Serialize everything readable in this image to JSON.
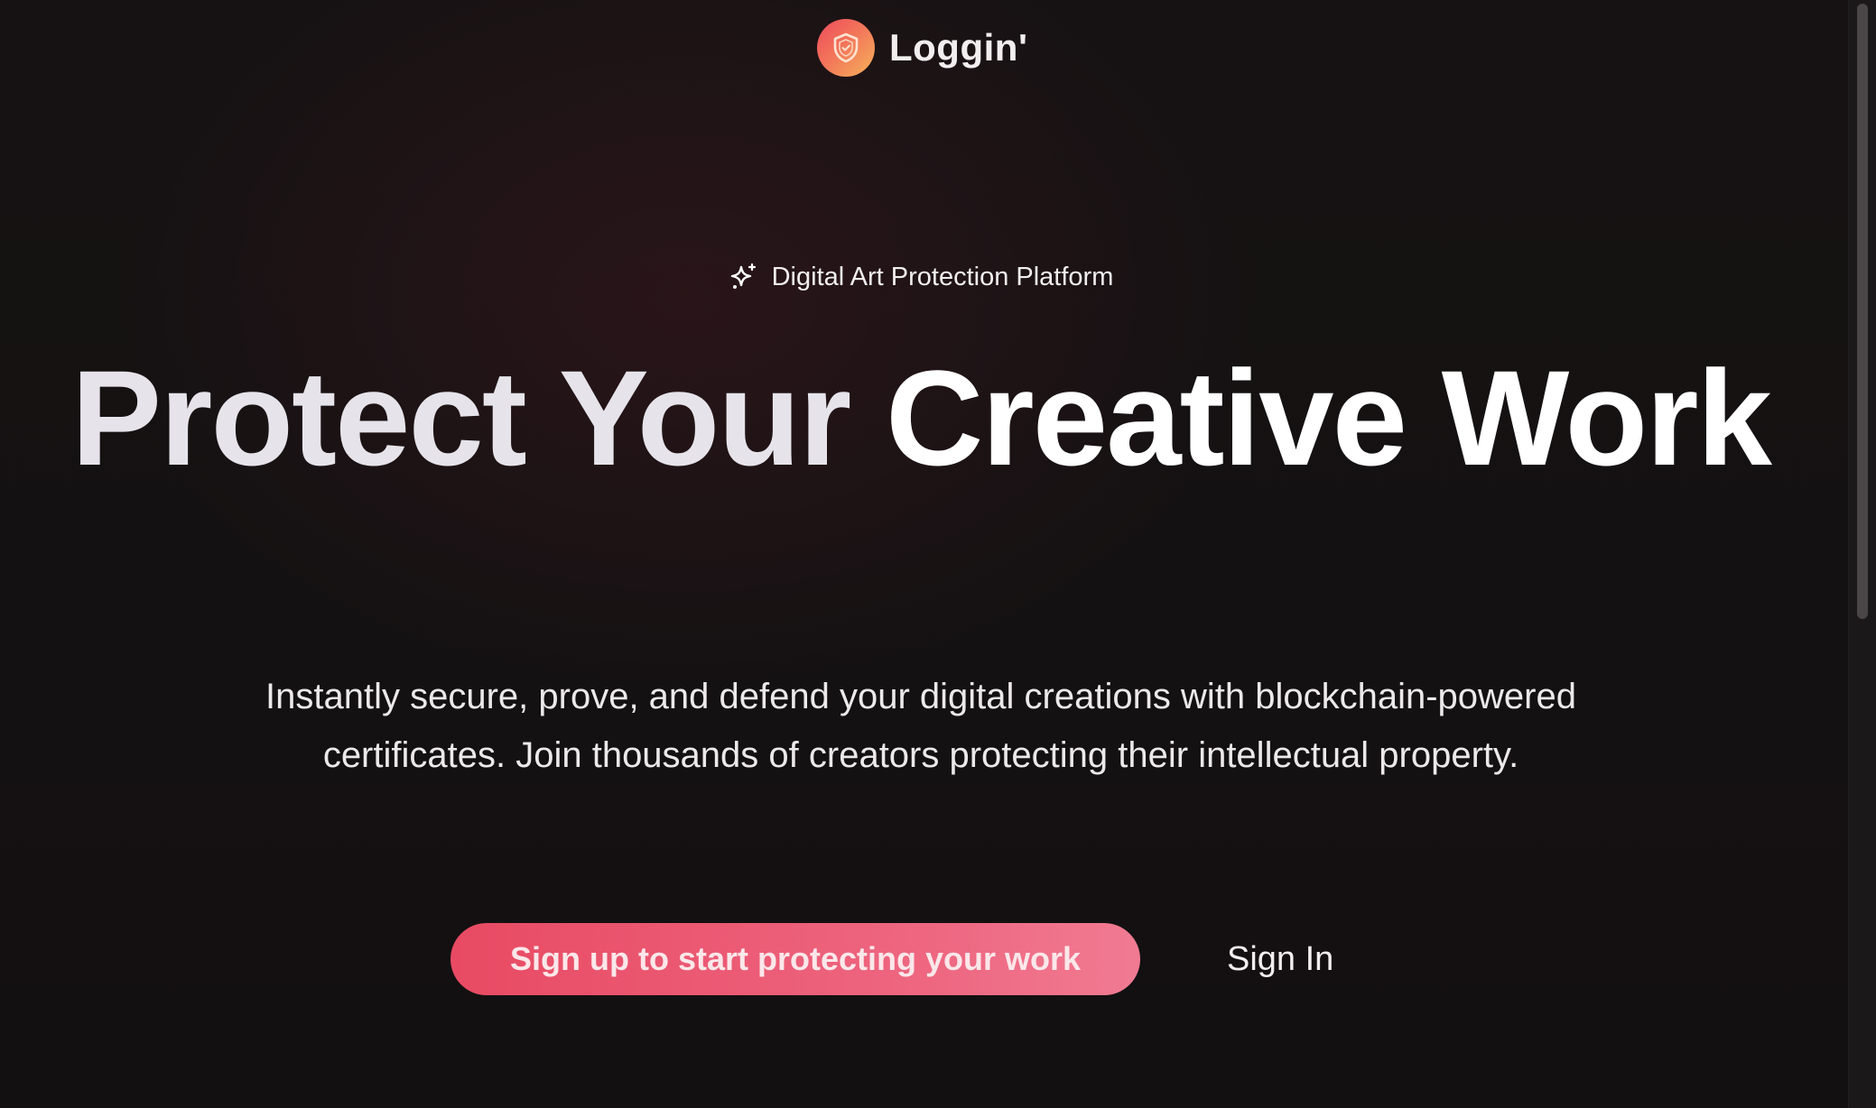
{
  "brand": {
    "name": "Loggin'",
    "logo_icon": "shield-check-icon",
    "logo_gradient": [
      "#ef4b5c",
      "#f6b35a"
    ]
  },
  "hero": {
    "badge_icon": "sparkle-icon",
    "badge_text": "Digital Art Protection Platform",
    "title_part1": "Protect Your ",
    "title_part2": "Creative Work",
    "subtitle": "Instantly secure, prove, and defend your digital creations with blockchain-powered certificates. Join thousands of creators protecting their intellectual property."
  },
  "actions": {
    "primary_label": "Sign up to start protecting your work",
    "primary_color": "#e84a63",
    "secondary_label": "Sign In"
  },
  "theme": {
    "background": "#141112",
    "text": "#ffffff"
  }
}
